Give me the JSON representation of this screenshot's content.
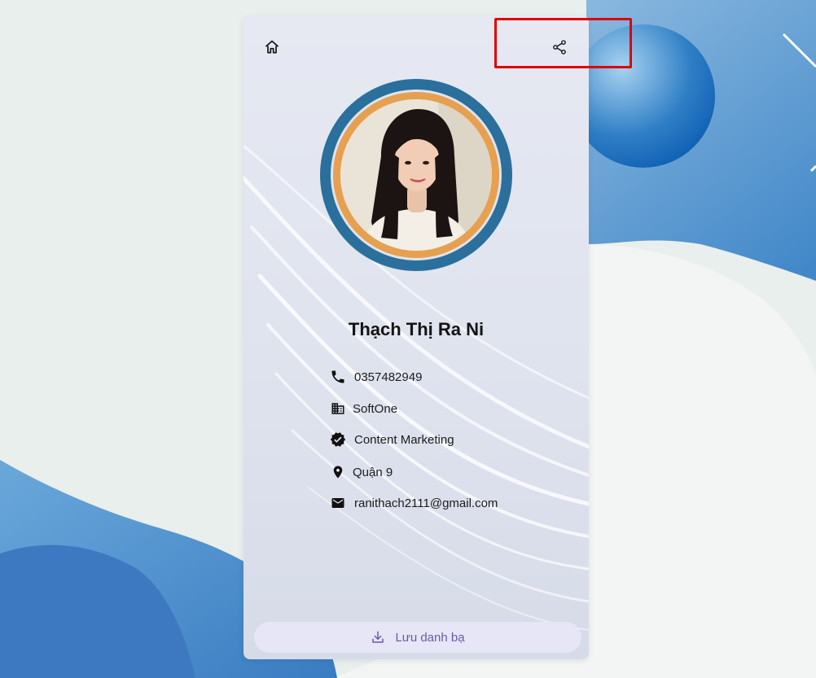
{
  "profile": {
    "name": "Thạch Thị Ra Ni",
    "phone": "0357482949",
    "company": "SoftOne",
    "position": "Content Marketing",
    "location": "Quận 9",
    "email": "ranithach2111@gmail.com"
  },
  "actions": {
    "save_label": "Lưu danh bạ"
  },
  "icons": {
    "home": "home-icon",
    "share": "share-icon",
    "phone": "phone-icon",
    "company": "building-icon",
    "position": "verified-badge-icon",
    "location": "location-pin-icon",
    "email": "mail-icon",
    "download": "download-icon"
  },
  "colors": {
    "ring_outer": "#2b6f9c",
    "ring_orange": "#e6a050",
    "save_button_bg": "#e6e6f6",
    "save_button_text": "#6a5aa8",
    "highlight": "#e00000"
  }
}
